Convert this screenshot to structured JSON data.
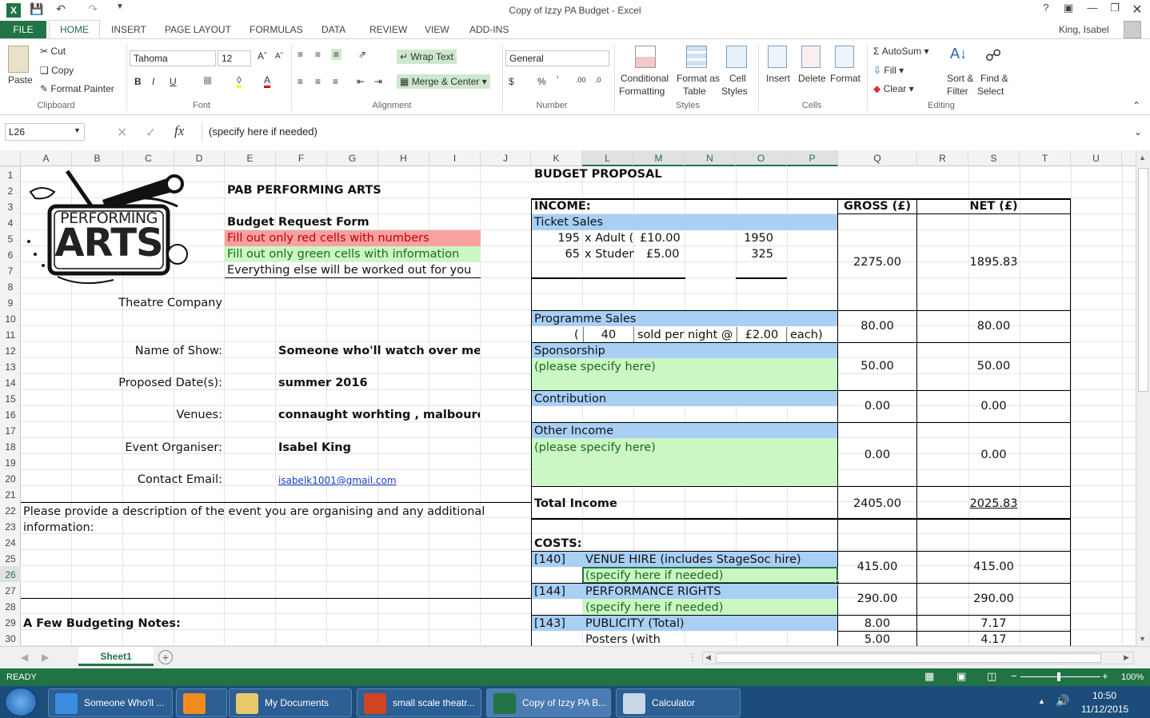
{
  "window": {
    "title": "Copy of Izzy PA Budget - Excel",
    "user": "King, Isabel"
  },
  "tabs": [
    "FILE",
    "HOME",
    "INSERT",
    "PAGE LAYOUT",
    "FORMULAS",
    "DATA",
    "REVIEW",
    "VIEW",
    "ADD-INS"
  ],
  "ribbon": {
    "clipboard": {
      "paste": "Paste",
      "cut": "Cut",
      "copy": "Copy",
      "format_painter": "Format Painter",
      "label": "Clipboard"
    },
    "font": {
      "name": "Tahoma",
      "size": "12",
      "label": "Font"
    },
    "alignment": {
      "wrap": "Wrap Text",
      "merge": "Merge & Center",
      "label": "Alignment"
    },
    "number": {
      "format": "General",
      "label": "Number"
    },
    "styles": {
      "cond1": "Conditional",
      "cond2": "Formatting",
      "fmt1": "Format as",
      "fmt2": "Table",
      "cell1": "Cell",
      "cell2": "Styles",
      "label": "Styles"
    },
    "cells": {
      "insert": "Insert",
      "delete": "Delete",
      "format": "Format",
      "label": "Cells"
    },
    "editing": {
      "autosum": "AutoSum",
      "fill": "Fill",
      "clear": "Clear",
      "sort1": "Sort &",
      "sort2": "Filter",
      "find1": "Find &",
      "find2": "Select",
      "label": "Editing"
    }
  },
  "formula_bar": {
    "name_box": "L26",
    "formula": "(specify here if needed)"
  },
  "columns": [
    "A",
    "B",
    "C",
    "D",
    "E",
    "F",
    "G",
    "H",
    "I",
    "J",
    "K",
    "L",
    "M",
    "N",
    "O",
    "P",
    "Q",
    "R",
    "S",
    "T",
    "U"
  ],
  "rows": [
    "1",
    "2",
    "3",
    "4",
    "5",
    "6",
    "7",
    "8",
    "9",
    "10",
    "11",
    "12",
    "13",
    "14",
    "15",
    "16",
    "17",
    "18",
    "19",
    "20",
    "21",
    "22",
    "23",
    "24",
    "25",
    "26",
    "27",
    "28",
    "29",
    "30"
  ],
  "logo": {
    "line1": "PERFORMING",
    "line2": "ARTS"
  },
  "left": {
    "org": "PAB PERFORMING ARTS",
    "form": "Budget Request Form",
    "red_note": "Fill out only red cells with numbers",
    "green_note": "Fill out only green cells with information",
    "else_note": "Everything else will be worked out for you",
    "company": "Theatre Company",
    "name_lbl": "Name of Show:",
    "name_val": "Someone who'll watch over me",
    "date_lbl": "Proposed Date(s):",
    "date_val": "summer 2016",
    "venue_lbl": "Venues:",
    "venue_val": "connaught worhting , malbourc",
    "org_lbl": "Event Organiser:",
    "org_val": "Isabel King",
    "email_lbl": "Contact Email:",
    "email_val": "isabelk1001@gmail.com",
    "desc1": "Please provide a description of the event you are organising and any additional",
    "desc2": "information:",
    "notes": "A Few Budgeting Notes:"
  },
  "budget": {
    "title": "BUDGET PROPOSAL",
    "income": "INCOME:",
    "gross": "GROSS (£)",
    "net": "NET (£)",
    "ticket": "Ticket Sales",
    "adult_n": "195",
    "adult_lbl": "x Adult (",
    "adult_price": "£10.00",
    "adult_total": "1950",
    "stud_n": "65",
    "stud_lbl": "x Studen",
    "stud_price": "£5.00",
    "stud_total": "325",
    "ticket_gross": "2275.00",
    "ticket_net": "1895.83",
    "prog": "Programme Sales",
    "prog_open": "(",
    "prog_n": "40",
    "prog_mid": "sold per night @",
    "prog_price": "£2.00",
    "prog_end": "each)",
    "prog_gross": "80.00",
    "prog_net": "80.00",
    "spons": "Sponsorship",
    "spons_spec": "(please specify here)",
    "spons_gross": "50.00",
    "spons_net": "50.00",
    "contrib": "Contribution",
    "contrib_gross": "0.00",
    "contrib_net": "0.00",
    "other": "Other Income",
    "other_spec": "(please specify here)",
    "other_gross": "0.00",
    "other_net": "0.00",
    "total": "Total Income",
    "total_gross": "2405.00",
    "total_net": "2025.83",
    "costs": "COSTS:",
    "venue_code": "[140]",
    "venue": "VENUE HIRE (includes StageSoc hire)",
    "venue_spec": "(specify here if needed)",
    "venue_gross": "415.00",
    "venue_net": "415.00",
    "perf_code": "[144]",
    "perf": "PERFORMANCE RIGHTS",
    "perf_spec": "(specify here if needed)",
    "perf_gross": "290.00",
    "perf_net": "290.00",
    "pub_code": "[143]",
    "pub": "PUBLICITY (Total)",
    "pub_gross": "8.00",
    "pub_net": "7.17",
    "posters": "Posters (with",
    "posters_gross": "5.00",
    "posters_net": "4.17"
  },
  "sheet": {
    "tab": "Sheet1"
  },
  "status": {
    "ready": "READY",
    "zoom": "100%"
  },
  "taskbar": {
    "items": [
      "Someone Who'll ...",
      "My Documents",
      "small scale theatr...",
      "Copy of Izzy PA B...",
      "Calculator"
    ],
    "time": "10:50",
    "date": "11/12/2015"
  },
  "colors": {
    "excel_green": "#217346",
    "income_blue": "#a9cff5",
    "input_green": "#cbf7c4",
    "input_red": "#f7a1a1"
  }
}
